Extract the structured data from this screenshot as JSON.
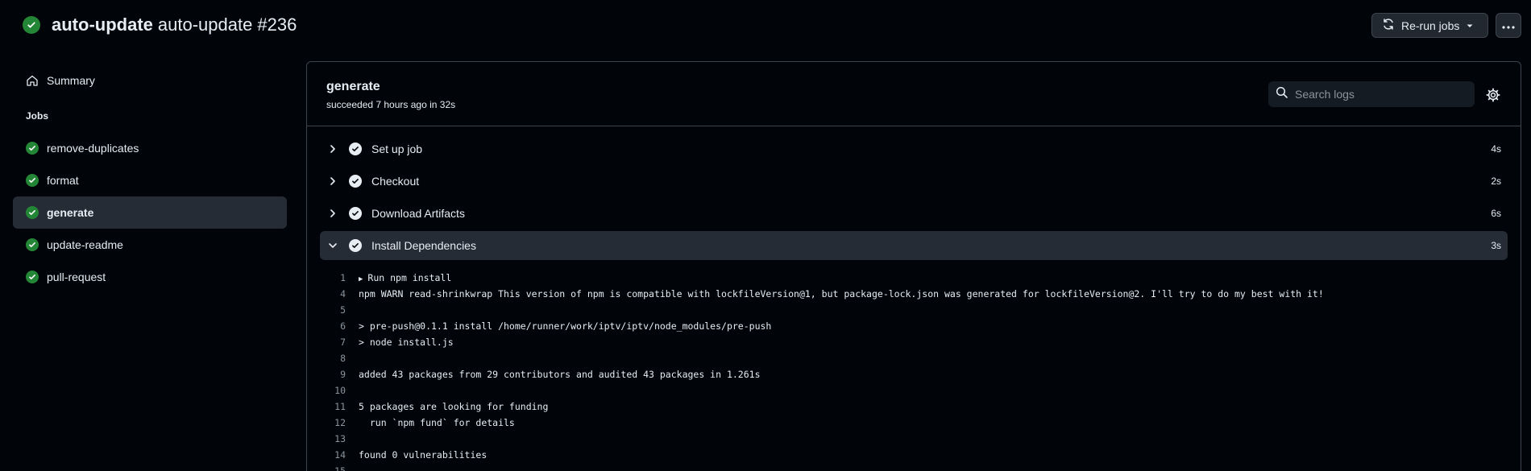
{
  "header": {
    "workflow": "auto-update",
    "run_title": "auto-update #236",
    "rerun_label": "Re-run jobs"
  },
  "sidebar": {
    "summary_label": "Summary",
    "jobs_heading": "Jobs",
    "jobs": [
      {
        "label": "remove-duplicates",
        "active": false
      },
      {
        "label": "format",
        "active": false
      },
      {
        "label": "generate",
        "active": true
      },
      {
        "label": "update-readme",
        "active": false
      },
      {
        "label": "pull-request",
        "active": false
      }
    ]
  },
  "job": {
    "name": "generate",
    "meta": "succeeded 7 hours ago in 32s",
    "search_placeholder": "Search logs"
  },
  "steps": [
    {
      "label": "Set up job",
      "duration": "4s"
    },
    {
      "label": "Checkout",
      "duration": "2s"
    },
    {
      "label": "Download Artifacts",
      "duration": "6s"
    },
    {
      "label": "Install Dependencies",
      "duration": "3s"
    }
  ],
  "log": [
    {
      "n": "1",
      "text": "Run npm install"
    },
    {
      "n": "4",
      "text": "npm WARN read-shrinkwrap This version of npm is compatible with lockfileVersion@1, but package-lock.json was generated for lockfileVersion@2. I'll try to do my best with it!"
    },
    {
      "n": "5",
      "text": ""
    },
    {
      "n": "6",
      "text": "> pre-push@0.1.1 install /home/runner/work/iptv/iptv/node_modules/pre-push"
    },
    {
      "n": "7",
      "text": "> node install.js"
    },
    {
      "n": "8",
      "text": ""
    },
    {
      "n": "9",
      "text": "added 43 packages from 29 contributors and audited 43 packages in 1.261s"
    },
    {
      "n": "10",
      "text": ""
    },
    {
      "n": "11",
      "text": "5 packages are looking for funding"
    },
    {
      "n": "12",
      "text": "  run `npm fund` for details"
    },
    {
      "n": "13",
      "text": ""
    },
    {
      "n": "14",
      "text": "found 0 vulnerabilities"
    },
    {
      "n": "15",
      "text": ""
    }
  ],
  "colors": {
    "success": "#238636",
    "background": "#010409",
    "border": "#3d444d"
  }
}
